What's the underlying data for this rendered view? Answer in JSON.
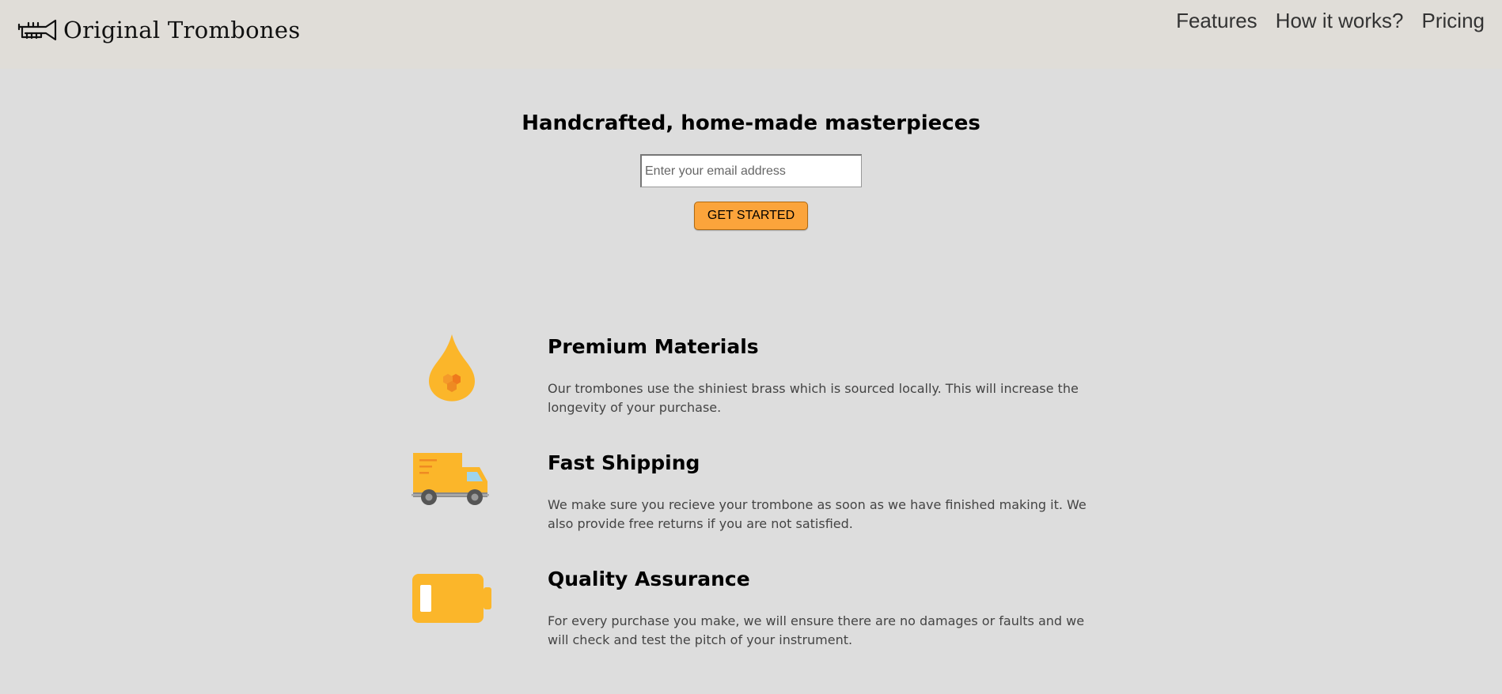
{
  "header": {
    "brand_name": "Original Trombones",
    "logo_icon": "trumpet-icon",
    "nav": [
      {
        "label": "Features"
      },
      {
        "label": "How it works?"
      },
      {
        "label": "Pricing"
      }
    ]
  },
  "hero": {
    "title": "Handcrafted, home-made masterpieces",
    "email_placeholder": "Enter your email address",
    "button_label": "GET STARTED"
  },
  "features": [
    {
      "icon": "droplet-icon",
      "title": "Premium Materials",
      "description": "Our trombones use the shiniest brass which is sourced locally. This will increase the longevity of your purchase."
    },
    {
      "icon": "truck-icon",
      "title": "Fast Shipping",
      "description": "We make sure you recieve your trombone as soon as we have finished making it. We also provide free returns if you are not satisfied."
    },
    {
      "icon": "battery-icon",
      "title": "Quality Assurance",
      "description": "For every purchase you make, we will ensure there are no damages or faults and we will check and test the pitch of your instrument."
    }
  ],
  "colors": {
    "header_bg": "#e0ddd8",
    "page_bg": "#dddddd",
    "accent": "#fba43b",
    "icon_yellow": "#fbb62a"
  }
}
